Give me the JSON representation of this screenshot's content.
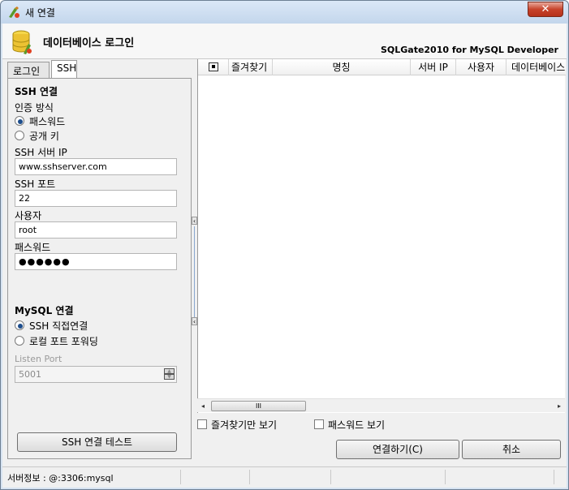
{
  "window": {
    "title": "새 연결",
    "close_label": "✕"
  },
  "header": {
    "title": "데이터베이스 로그인",
    "product": "SQLGate2010 for MySQL Developer"
  },
  "tabs": [
    {
      "label": "로그인"
    },
    {
      "label": "SSH"
    }
  ],
  "ssh": {
    "section_title": "SSH 연결",
    "auth_label": "인증 방식",
    "auth_options": [
      {
        "label": "패스워드",
        "selected": true
      },
      {
        "label": "공개 키",
        "selected": false
      }
    ],
    "server_ip_label": "SSH 서버 IP",
    "server_ip_value": "www.sshserver.com",
    "port_label": "SSH 포트",
    "port_value": "22",
    "user_label": "사용자",
    "user_value": "root",
    "password_label": "패스워드",
    "password_value": "●●●●●●"
  },
  "mysql": {
    "section_title": "MySQL 연결",
    "options": [
      {
        "label": "SSH 직접연결",
        "selected": true
      },
      {
        "label": "로컬 포트 포워딩",
        "selected": false
      }
    ],
    "listen_port_label": "Listen Port",
    "listen_port_value": "5001"
  },
  "test_button": "SSH 연결 테스트",
  "grid": {
    "columns": [
      "즐겨찾기",
      "명칭",
      "서버 IP",
      "사용자",
      "데이터베이스"
    ],
    "scroll_thumb": "III"
  },
  "options": {
    "favorites_only": "즐겨찾기만 보기",
    "show_password": "패스워드 보기"
  },
  "buttons": {
    "connect": "연결하기(C)",
    "cancel": "취소"
  },
  "status": {
    "server_info": "서버정보 : @:3306:mysql"
  }
}
